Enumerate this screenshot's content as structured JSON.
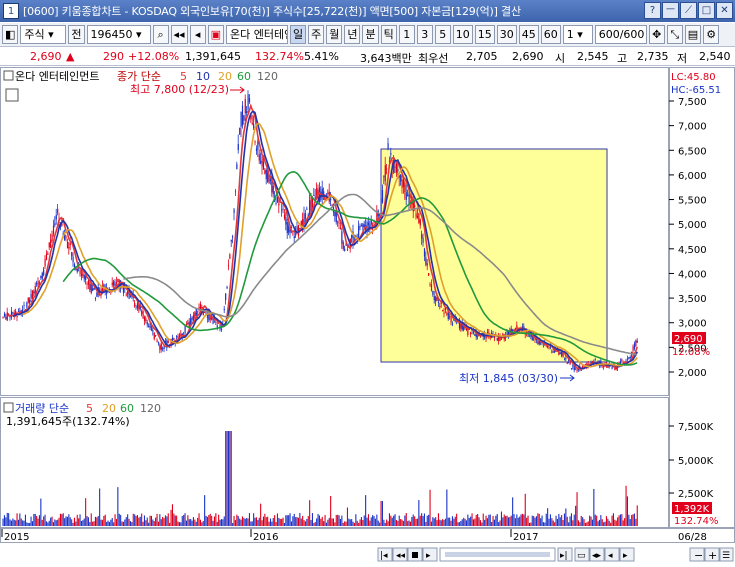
{
  "titlebar": {
    "code": "1",
    "title": "[0600] 키움종합차트 - KOSDAQ 외국인보유[70(천)] 주식수[25,722(천)] 액면[500] 자본금[129(억)] 결산",
    "buttons": [
      "?",
      "ㅡ",
      "⟋",
      "□",
      "✕"
    ]
  },
  "toolbar": {
    "type_select": "주식",
    "prev_label": "전",
    "code_input": "196450",
    "stock_name": "온다 엔터테인",
    "periods": [
      "일",
      "주",
      "월",
      "년",
      "분",
      "틱"
    ],
    "selected_period": "일",
    "minutes": [
      "1",
      "3",
      "5",
      "10",
      "15",
      "30",
      "45",
      "60"
    ],
    "unit_select": "1",
    "count": "600/600"
  },
  "quote": {
    "price": "2,690",
    "change": "290",
    "change_pct": "+12.08%",
    "volume": "1,391,645",
    "volume_ratio": "132.74%",
    "turnover": "5.41%",
    "amount": "3,643백만",
    "best_ask_label": "최우선",
    "best_ask": "2,705",
    "best_bid": "2,690",
    "open_label": "시",
    "open": "2,545",
    "high_label": "고",
    "high": "2,735",
    "low_label": "저",
    "low": "2,540"
  },
  "price_panel": {
    "stock_label": "온다 엔터테인먼트",
    "legend_prefix": "종가 단순",
    "legend_ma": [
      "5",
      "10",
      "20",
      "60",
      "120"
    ],
    "lc_label": "LC:45.80",
    "hc_label": "HC:-65.51",
    "max_annotation": "최고 7,800 (12/23)",
    "min_annotation": "최저 1,845 (03/30)",
    "current_price_tag": "2,690",
    "current_pct_tag": "12.08%",
    "y_ticks": [
      "7,500",
      "7,000",
      "6,500",
      "6,000",
      "5,500",
      "5,000",
      "4,500",
      "4,000",
      "3,500",
      "3,000",
      "2,500",
      "2,000"
    ]
  },
  "volume_panel": {
    "legend_prefix": "거래량 단순",
    "legend_ma": [
      "5",
      "20",
      "60",
      "120"
    ],
    "current_value": "1,391,645주(132.74%)",
    "y_ticks": [
      "7,500K",
      "5,000K",
      "2,500K"
    ],
    "current_tag": "1,392K",
    "current_pct_tag": "132.74%"
  },
  "x_axis": {
    "labels": [
      "2015",
      "2016",
      "2017"
    ],
    "date_tag": "06/28"
  },
  "colors": {
    "up": "#e0001b",
    "down": "#1a34c8",
    "ma5": "#e23a3a",
    "ma10": "#2233aa",
    "ma20": "#e0a02a",
    "ma60": "#1f9a3c",
    "ma120": "#8a8a8a",
    "highlight": "#ffff99"
  }
}
